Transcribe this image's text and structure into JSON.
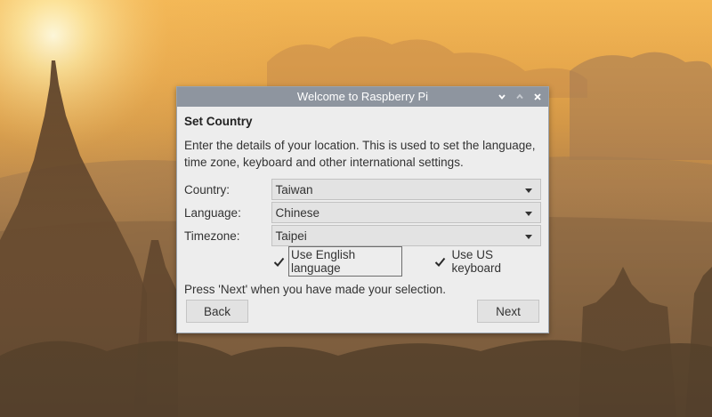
{
  "window": {
    "title": "Welcome to Raspberry Pi"
  },
  "page": {
    "heading": "Set Country",
    "description": "Enter the details of your location. This is used to set the language, time zone, keyboard and other international settings.",
    "footer": "Press 'Next' when you have made your selection."
  },
  "form": {
    "country_label": "Country:",
    "country_value": "Taiwan",
    "language_label": "Language:",
    "language_value": "Chinese",
    "timezone_label": "Timezone:",
    "timezone_value": "Taipei",
    "use_english_label": "Use English language",
    "use_english_checked": true,
    "use_us_keyboard_label": "Use US keyboard",
    "use_us_keyboard_checked": true
  },
  "buttons": {
    "back": "Back",
    "next": "Next"
  },
  "icons": {
    "minimize": "chevron-down-icon",
    "maximize": "chevron-up-icon",
    "close": "close-icon"
  },
  "colors": {
    "titlebar": "#8e959f",
    "dialog_bg": "#ededed"
  }
}
